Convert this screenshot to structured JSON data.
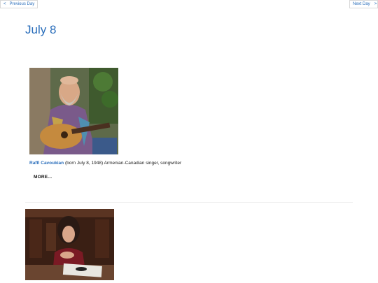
{
  "nav": {
    "prev_arrow": "<",
    "prev_label": "Previous Day",
    "next_label": "Next Day",
    "next_arrow": ">"
  },
  "page": {
    "title": "July 8"
  },
  "entries": [
    {
      "name": "Raffi Cavoukian",
      "description": "(born July 8, 1948) Armenian-Canadian singer, songwriter",
      "more_label": "MORE...",
      "photo_icon": "portrait-with-guitar"
    },
    {
      "photo_icon": "portrait-seated-woman"
    }
  ]
}
